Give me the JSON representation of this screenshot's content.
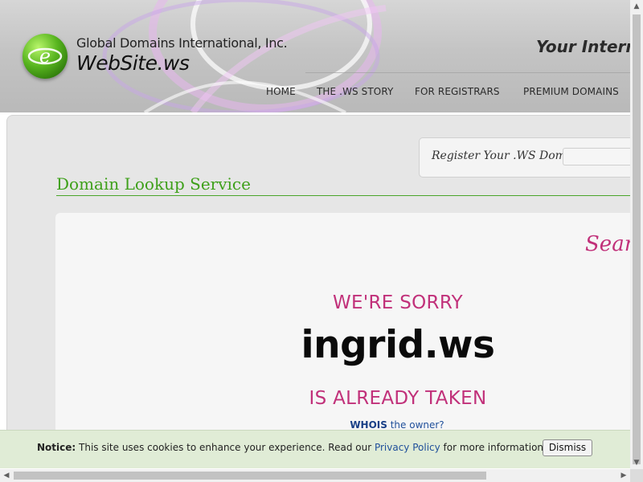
{
  "header": {
    "company": "Global Domains International, Inc.",
    "site": "WebSite.ws",
    "tagline": "Your Interne",
    "nav": [
      "HOME",
      "THE .WS STORY",
      "FOR REGISTRARS",
      "PREMIUM DOMAINS"
    ]
  },
  "register": {
    "label": "Register Your .WS Domain",
    "input_value": ""
  },
  "main": {
    "section_title": "Domain Lookup Service",
    "search_heading": "Searc",
    "sorry": "WE'RE SORRY",
    "domain": "ingrid.ws",
    "taken": "IS ALREADY TAKEN",
    "whois_bold": "WHOIS",
    "whois_rest": " the owner?"
  },
  "cookie": {
    "notice_label": "Notice:",
    "text_before": " This site uses cookies to enhance your experience. Read our ",
    "link": "Privacy Policy",
    "text_after": " for more information.",
    "dismiss": "Dismiss"
  },
  "colors": {
    "accent_green": "#3ea01a",
    "accent_pink": "#c1317a",
    "link_blue": "#1f4f9a"
  }
}
